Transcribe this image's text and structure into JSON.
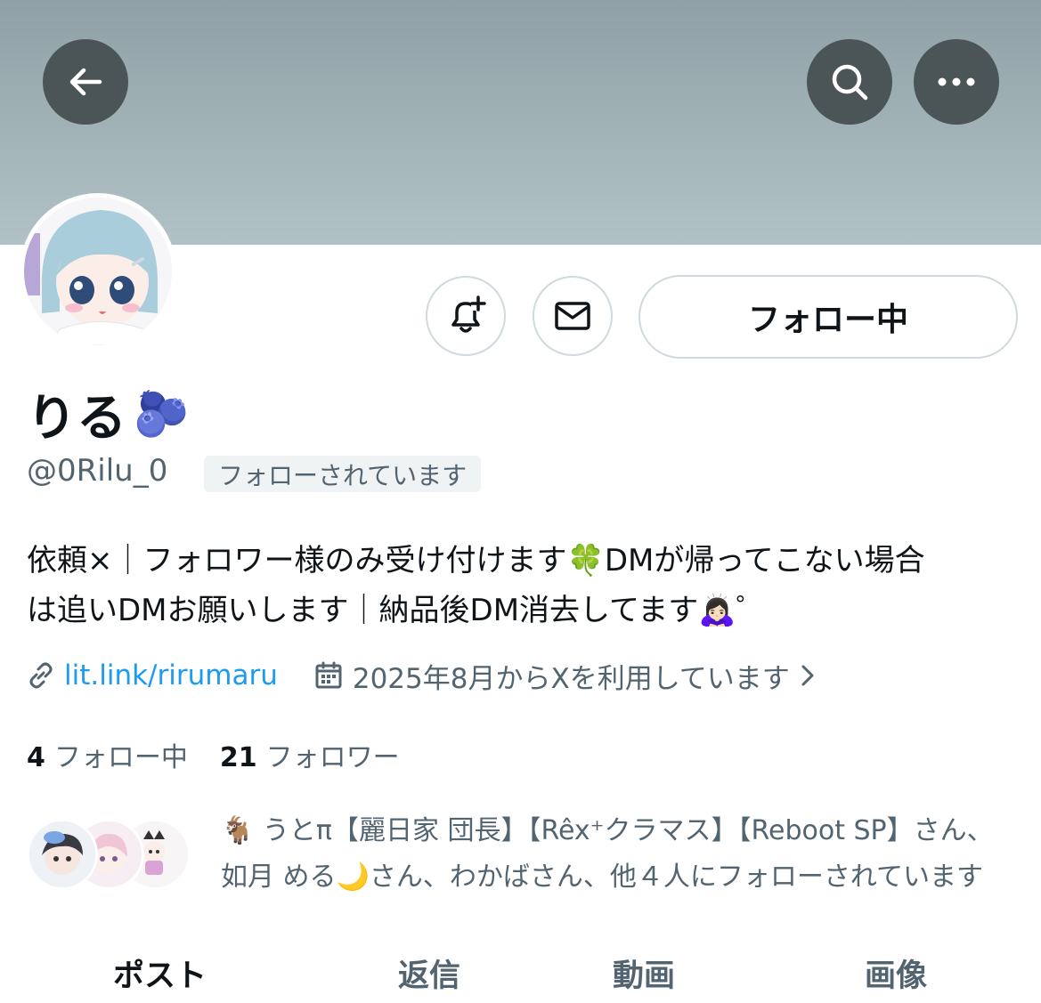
{
  "profile": {
    "display_name": "りる",
    "name_emoji": "🫐",
    "handle": "@0Rilu_0",
    "follows_you_badge": "フォローされています",
    "bio_line1": "依頼×｜フォロワー様のみ受け付けます🍀DMが帰ってこない場合",
    "bio_line2": "は追いDMお願いします｜納品後DM消去してます🙇🏻‍♀️゜",
    "link": "lit.link/rirumaru",
    "joined": "2025年8月からXを利用しています",
    "following_count": "4",
    "following_label": "フォロー中",
    "followers_count": "21",
    "followers_label": "フォロワー",
    "followed_by_line1": "🐐 うとπ【麗日家 団長】【Rêx⁺クラマス】【Reboot SP】さん、",
    "followed_by_line2": "如月 める🌙さん、わかばさん、他４人にフォローされています"
  },
  "actions": {
    "follow_button": "フォロー中",
    "back_icon": "arrow-left-icon",
    "search_icon": "search-icon",
    "more_icon": "more-horizontal-icon",
    "notify_icon": "bell-plus-icon",
    "message_icon": "mail-icon"
  },
  "tabs": [
    {
      "label": "ポスト",
      "active": true
    },
    {
      "label": "返信",
      "active": false
    },
    {
      "label": "動画",
      "active": false
    },
    {
      "label": "画像",
      "active": false
    }
  ],
  "colors": {
    "link": "#1d9bf0",
    "secondary_text": "#536471",
    "button_border": "#cfd9de",
    "banner": "#9aabb0"
  }
}
